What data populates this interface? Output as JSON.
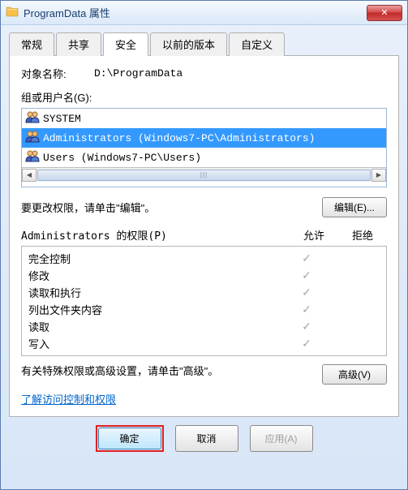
{
  "window": {
    "title": "ProgramData 属性",
    "close": "✕"
  },
  "tabs": [
    {
      "label": "常规"
    },
    {
      "label": "共享"
    },
    {
      "label": "安全",
      "active": true
    },
    {
      "label": "以前的版本"
    },
    {
      "label": "自定义"
    }
  ],
  "object": {
    "label": "对象名称:",
    "value": "D:\\ProgramData"
  },
  "groups": {
    "label": "组或用户名(G):",
    "items": [
      {
        "name": "SYSTEM",
        "selected": false
      },
      {
        "name": "Administrators (Windows7-PC\\Administrators)",
        "selected": true
      },
      {
        "name": "Users (Windows7-PC\\Users)",
        "selected": false
      }
    ]
  },
  "edit": {
    "text": "要更改权限，请单击\"编辑\"。",
    "button": "编辑(E)..."
  },
  "permissions": {
    "header_label": "Administrators 的权限(P)",
    "allow": "允许",
    "deny": "拒绝",
    "rows": [
      {
        "label": "完全控制",
        "allow": true,
        "deny": false
      },
      {
        "label": "修改",
        "allow": true,
        "deny": false
      },
      {
        "label": "读取和执行",
        "allow": true,
        "deny": false
      },
      {
        "label": "列出文件夹内容",
        "allow": true,
        "deny": false
      },
      {
        "label": "读取",
        "allow": true,
        "deny": false
      },
      {
        "label": "写入",
        "allow": true,
        "deny": false
      }
    ]
  },
  "advanced": {
    "text": "有关特殊权限或高级设置，请单击\"高级\"。",
    "button": "高级(V)"
  },
  "link": "了解访问控制和权限",
  "buttons": {
    "ok": "确定",
    "cancel": "取消",
    "apply": "应用(A)"
  }
}
